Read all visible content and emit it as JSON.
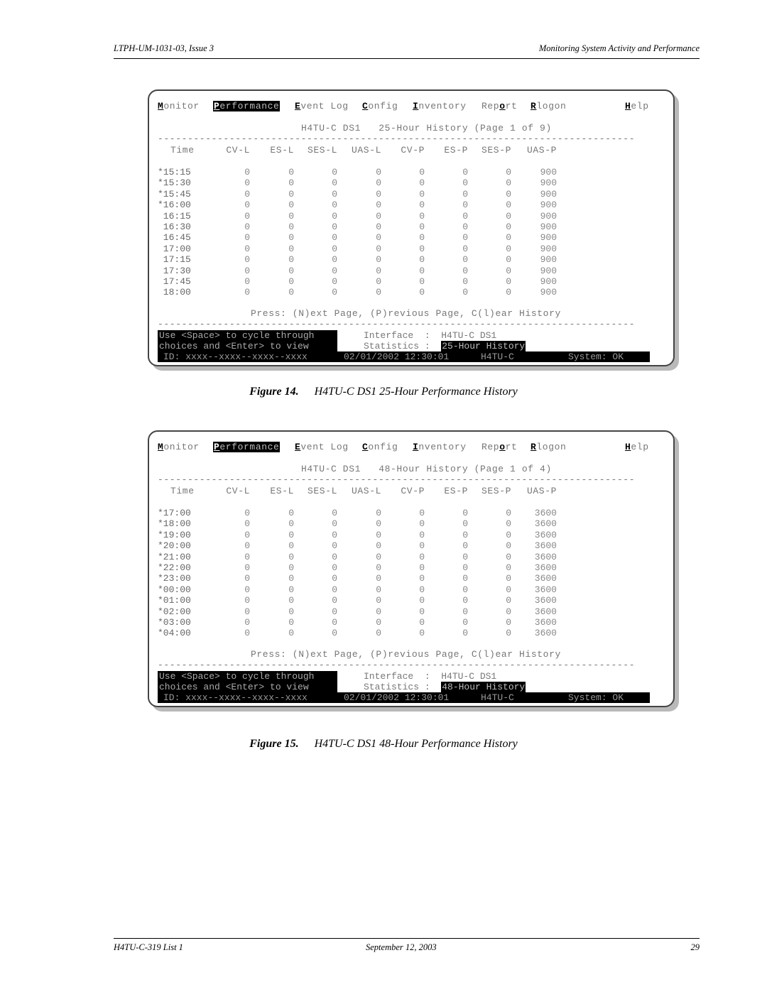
{
  "header": {
    "doc_id": "LTPH-UM-1031-03, Issue 3",
    "section": "Monitoring System Activity and Performance"
  },
  "footer": {
    "product": "H4TU-C-319 List 1",
    "date": "September 12, 2003",
    "page_number": "29"
  },
  "menu": {
    "items": [
      {
        "hot": "M",
        "rest": "onitor",
        "selected": false
      },
      {
        "hot": "P",
        "rest": "erformance",
        "selected": true
      },
      {
        "hot": "E",
        "rest": "vent Log",
        "selected": false
      },
      {
        "hot": "C",
        "rest": "onfig",
        "selected": false
      },
      {
        "hot": "I",
        "rest": "nventory",
        "selected": false
      },
      {
        "pre": "Rep",
        "hot": "o",
        "rest": "rt",
        "selected": false
      },
      {
        "hot": "R",
        "rest": "logon",
        "selected": false
      },
      {
        "hot": "H",
        "rest": "elp",
        "selected": false
      }
    ]
  },
  "columns": [
    "Time",
    "CV-L",
    "ES-L",
    "SES-L",
    "UAS-L",
    "CV-P",
    "ES-P",
    "SES-P",
    "UAS-P"
  ],
  "dashes": "--------------------------------------------------------------------------------",
  "figures": [
    {
      "screen_title": "H4TU-C DS1   25-Hour History (Page 1 of 9)",
      "rows": [
        [
          "*15:15",
          "0",
          "0",
          "0",
          "0",
          "0",
          "0",
          "0",
          "900"
        ],
        [
          "*15:30",
          "0",
          "0",
          "0",
          "0",
          "0",
          "0",
          "0",
          "900"
        ],
        [
          "*15:45",
          "0",
          "0",
          "0",
          "0",
          "0",
          "0",
          "0",
          "900"
        ],
        [
          "*16:00",
          "0",
          "0",
          "0",
          "0",
          "0",
          "0",
          "0",
          "900"
        ],
        [
          " 16:15",
          "0",
          "0",
          "0",
          "0",
          "0",
          "0",
          "0",
          "900"
        ],
        [
          " 16:30",
          "0",
          "0",
          "0",
          "0",
          "0",
          "0",
          "0",
          "900"
        ],
        [
          " 16:45",
          "0",
          "0",
          "0",
          "0",
          "0",
          "0",
          "0",
          "900"
        ],
        [
          " 17:00",
          "0",
          "0",
          "0",
          "0",
          "0",
          "0",
          "0",
          "900"
        ],
        [
          " 17:15",
          "0",
          "0",
          "0",
          "0",
          "0",
          "0",
          "0",
          "900"
        ],
        [
          " 17:30",
          "0",
          "0",
          "0",
          "0",
          "0",
          "0",
          "0",
          "900"
        ],
        [
          " 17:45",
          "0",
          "0",
          "0",
          "0",
          "0",
          "0",
          "0",
          "900"
        ],
        [
          " 18:00",
          "0",
          "0",
          "0",
          "0",
          "0",
          "0",
          "0",
          "900"
        ]
      ],
      "press_hint": "Press: (N)ext Page, (P)revious Page, C(l)ear History",
      "hint_line1": "Use <Space> to cycle through",
      "hint_line2": "choices and <Enter> to view",
      "interface_label": "Interface  :  ",
      "interface_value": "H4TU-C DS1",
      "statistics_label": "Statistics :  ",
      "statistics_value": "25-Hour History",
      "status_id": "ID: xxxx--xxxx--xxxx--xxxx",
      "status_datetime": "02/01/2002 12:30:01",
      "status_unit": "H4TU-C",
      "status_system": "System: OK",
      "caption_label": "Figure 14.",
      "caption_text": "H4TU-C DS1 25-Hour Performance History"
    },
    {
      "screen_title": "H4TU-C DS1   48-Hour History (Page 1 of 4)",
      "rows": [
        [
          "*17:00",
          "0",
          "0",
          "0",
          "0",
          "0",
          "0",
          "0",
          "3600"
        ],
        [
          "*18:00",
          "0",
          "0",
          "0",
          "0",
          "0",
          "0",
          "0",
          "3600"
        ],
        [
          "*19:00",
          "0",
          "0",
          "0",
          "0",
          "0",
          "0",
          "0",
          "3600"
        ],
        [
          "*20:00",
          "0",
          "0",
          "0",
          "0",
          "0",
          "0",
          "0",
          "3600"
        ],
        [
          "*21:00",
          "0",
          "0",
          "0",
          "0",
          "0",
          "0",
          "0",
          "3600"
        ],
        [
          "*22:00",
          "0",
          "0",
          "0",
          "0",
          "0",
          "0",
          "0",
          "3600"
        ],
        [
          "*23:00",
          "0",
          "0",
          "0",
          "0",
          "0",
          "0",
          "0",
          "3600"
        ],
        [
          "*00:00",
          "0",
          "0",
          "0",
          "0",
          "0",
          "0",
          "0",
          "3600"
        ],
        [
          "*01:00",
          "0",
          "0",
          "0",
          "0",
          "0",
          "0",
          "0",
          "3600"
        ],
        [
          "*02:00",
          "0",
          "0",
          "0",
          "0",
          "0",
          "0",
          "0",
          "3600"
        ],
        [
          "*03:00",
          "0",
          "0",
          "0",
          "0",
          "0",
          "0",
          "0",
          "3600"
        ],
        [
          "*04:00",
          "0",
          "0",
          "0",
          "0",
          "0",
          "0",
          "0",
          "3600"
        ]
      ],
      "press_hint": "Press: (N)ext Page, (P)revious Page, C(l)ear History",
      "hint_line1": "Use <Space> to cycle through",
      "hint_line2": "choices and <Enter> to view",
      "interface_label": "Interface  :  ",
      "interface_value": "H4TU-C DS1",
      "statistics_label": "Statistics :  ",
      "statistics_value": "48-Hour History",
      "status_id": "ID: xxxx--xxxx--xxxx--xxxx",
      "status_datetime": "02/01/2002 12:30:01",
      "status_unit": "H4TU-C",
      "status_system": "System: OK",
      "caption_label": "Figure 15.",
      "caption_text": "H4TU-C DS1 48-Hour Performance History"
    }
  ]
}
